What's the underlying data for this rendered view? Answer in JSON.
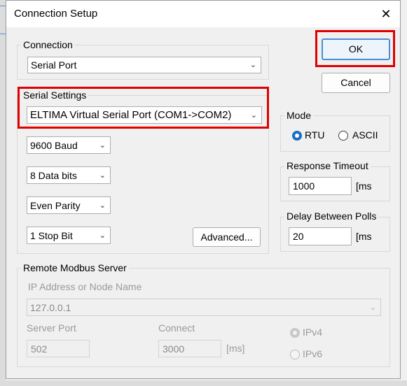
{
  "dialog": {
    "title": "Connection Setup",
    "close_glyph": "✕"
  },
  "connection": {
    "group_label": "Connection",
    "type_value": "Serial Port"
  },
  "buttons": {
    "ok": "OK",
    "cancel": "Cancel",
    "advanced": "Advanced..."
  },
  "serial": {
    "group_label": "Serial Settings",
    "port_value": "ELTIMA Virtual Serial Port (COM1->COM2)",
    "baud_value": "9600 Baud",
    "data_bits_value": "8 Data bits",
    "parity_value": "Even Parity",
    "stop_bits_value": "1 Stop Bit"
  },
  "mode": {
    "group_label": "Mode",
    "options": [
      "RTU",
      "ASCII"
    ],
    "selected": "RTU"
  },
  "response_timeout": {
    "label": "Response Timeout",
    "value": "1000",
    "unit": "[ms"
  },
  "delay_polls": {
    "label": "Delay Between Polls",
    "value": "20",
    "unit": "[ms"
  },
  "remote": {
    "group_label": "Remote Modbus Server",
    "ip_label": "IP Address or Node Name",
    "ip_value": "127.0.0.1",
    "port_label": "Server Port",
    "port_value": "502",
    "connect_label": "Connect",
    "connect_value": "3000",
    "connect_unit": "[ms]",
    "ip_versions": [
      "IPv4",
      "IPv6"
    ],
    "ip_version_selected": "IPv4"
  },
  "icons": {
    "dropdown": "chevron-down-icon",
    "close": "close-icon"
  },
  "colors": {
    "highlight": "#e00000",
    "accent": "#1a6fc4",
    "ok_border": "#4a8fd3"
  }
}
